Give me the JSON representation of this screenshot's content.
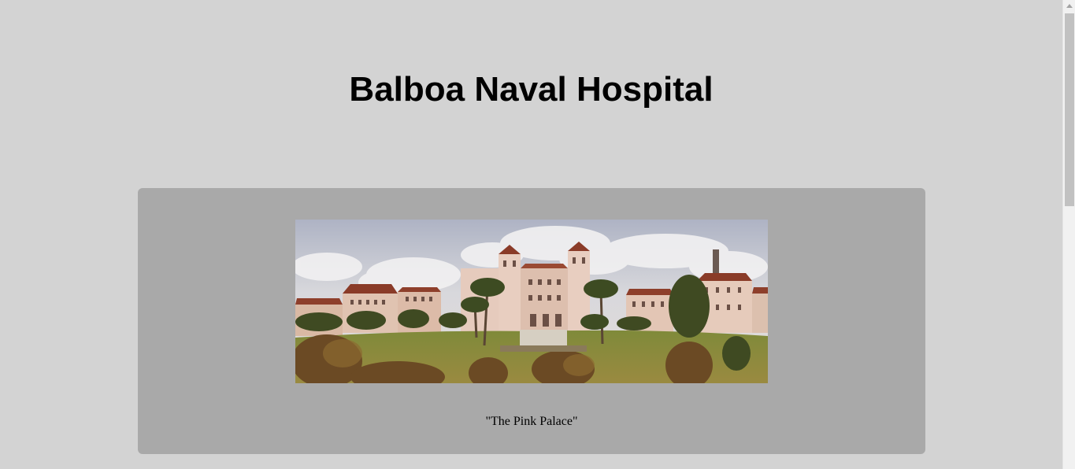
{
  "page": {
    "title": "Balboa Naval Hospital",
    "background_color": "#d3d3d3"
  },
  "card": {
    "background_color": "#a9a9a9",
    "photo_alt": "Balboa Naval Hospital",
    "caption": "\"The Pink Palace\""
  },
  "scrollbar": {
    "up_icon": "chevron-up-icon"
  }
}
